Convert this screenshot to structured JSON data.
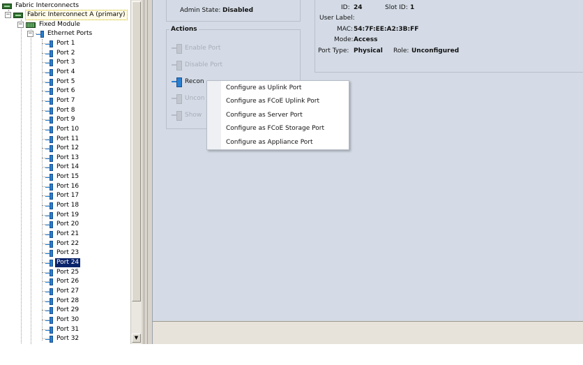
{
  "tree": {
    "root_label": "Fabric Interconnects",
    "fi_label": "Fabric Interconnect A (primary)",
    "module_label": "Fixed Module",
    "ports_group_label": "Ethernet Ports",
    "ports": [
      "Port 1",
      "Port 2",
      "Port 3",
      "Port 4",
      "Port 5",
      "Port 6",
      "Port 7",
      "Port 8",
      "Port 9",
      "Port 10",
      "Port 11",
      "Port 12",
      "Port 13",
      "Port 14",
      "Port 15",
      "Port 16",
      "Port 17",
      "Port 18",
      "Port 19",
      "Port 20",
      "Port 21",
      "Port 22",
      "Port 23",
      "Port 24",
      "Port 25",
      "Port 26",
      "Port 27",
      "Port 28",
      "Port 29",
      "Port 30",
      "Port 31",
      "Port 32"
    ],
    "selected_port": "Port 24",
    "expander_minus": "−",
    "scroll_down_glyph": "▼"
  },
  "status": {
    "admin_state_label": "Admin State:",
    "admin_state_value": "Disabled"
  },
  "actions": {
    "title": "Actions",
    "items": [
      {
        "label": "Enable Port",
        "enabled": false
      },
      {
        "label": "Disable Port",
        "enabled": false
      },
      {
        "label": "Recon",
        "enabled": true
      },
      {
        "label": "Uncon",
        "enabled": false
      },
      {
        "label": "Show",
        "enabled": false
      }
    ]
  },
  "properties": {
    "id_label": "ID:",
    "id_value": "24",
    "slot_label": "Slot ID:",
    "slot_value": "1",
    "user_label_label": "User Label:",
    "user_label_value": "",
    "mac_label": "MAC:",
    "mac_value": "54:7F:EE:A2:3B:FF",
    "mode_label": "Mode:",
    "mode_value": "Access",
    "port_type_label": "Port Type:",
    "port_type_value": "Physical",
    "role_label": "Role:",
    "role_value": "Unconfigured"
  },
  "context_menu": {
    "items": [
      "Configure as Uplink Port",
      "Configure as FCoE Uplink Port",
      "Configure as Server Port",
      "Configure as FCoE Storage Port",
      "Configure as Appliance Port"
    ]
  },
  "colors": {
    "content_bg": "#d4dbe6",
    "selection_bg": "#0a246a",
    "port_icon": "#2a7fcf",
    "fi_icon": "#2e6f2e"
  }
}
